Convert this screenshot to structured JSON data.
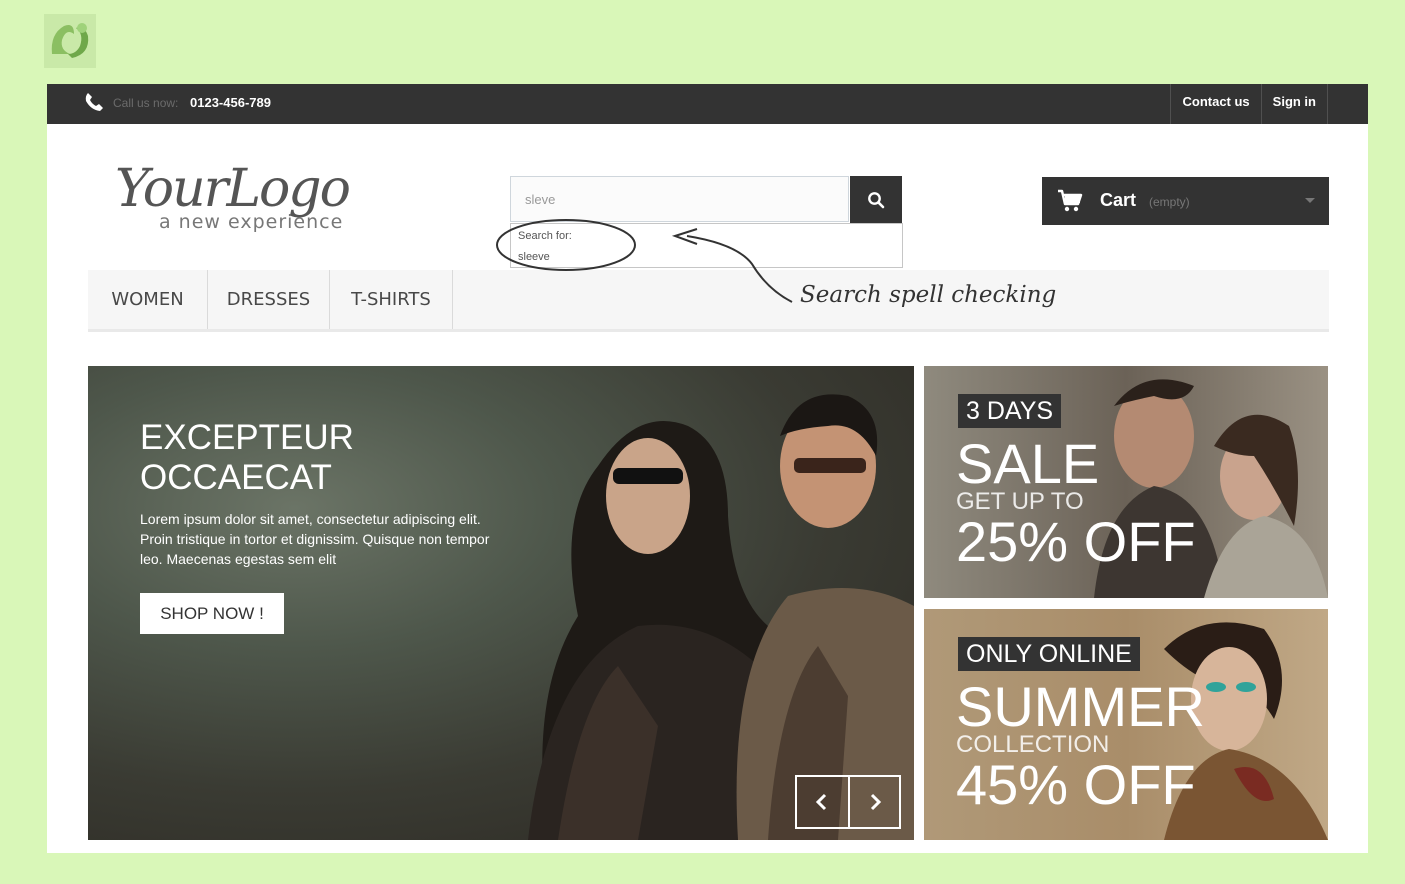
{
  "header": {
    "call_label": "Call us now:",
    "phone": "0123-456-789",
    "links": [
      "Contact us",
      "Sign in"
    ]
  },
  "logo": {
    "main": "YourLogo",
    "tagline": "a new experience"
  },
  "search": {
    "value": "sleve",
    "suggest_label": "Search for:",
    "suggest_item": "sleeve"
  },
  "cart": {
    "label": "Cart",
    "status": "(empty)"
  },
  "menu": [
    "WOMEN",
    "DRESSES",
    "T-SHIRTS"
  ],
  "annotation": "Search spell checking",
  "slider": {
    "title_line1": "EXCEPTEUR",
    "title_line2": "OCCAECAT",
    "text": "Lorem ipsum dolor sit amet, consectetur adipiscing elit. Proin tristique in tortor et dignissim. Quisque non tempor leo. Maecenas egestas sem elit",
    "button": "SHOP NOW !"
  },
  "banners": [
    {
      "tag": "3 DAYS",
      "big": "SALE",
      "mid": "GET UP TO",
      "offer": "25% OFF"
    },
    {
      "tag": "ONLY ONLINE",
      "big": "SUMMER",
      "mid": "COLLECTION",
      "offer": "45% OFF"
    }
  ],
  "colors": {
    "background": "#d9f7b8",
    "topbar": "#333333",
    "menu_bg": "#f6f6f6",
    "accent_dark": "#333333"
  }
}
